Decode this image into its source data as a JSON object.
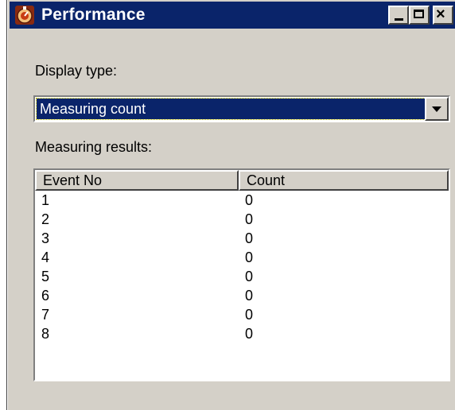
{
  "window": {
    "title": "Performance",
    "icon": "app-performance-icon",
    "controls": {
      "minimize": "minimize-icon",
      "maximize": "maximize-icon",
      "close": "close-icon",
      "close_glyph": "×"
    }
  },
  "display_type": {
    "label": "Display type:",
    "selected": "Measuring count"
  },
  "results": {
    "label": "Measuring results:",
    "columns": [
      "Event No",
      "Count"
    ],
    "rows": [
      {
        "event": "1",
        "count": "0"
      },
      {
        "event": "2",
        "count": "0"
      },
      {
        "event": "3",
        "count": "0"
      },
      {
        "event": "4",
        "count": "0"
      },
      {
        "event": "5",
        "count": "0"
      },
      {
        "event": "6",
        "count": "0"
      },
      {
        "event": "7",
        "count": "0"
      },
      {
        "event": "8",
        "count": "0"
      }
    ]
  },
  "colors": {
    "titlebar": "#0a246a",
    "face": "#d4d0c8",
    "selection": "#0a246a"
  }
}
